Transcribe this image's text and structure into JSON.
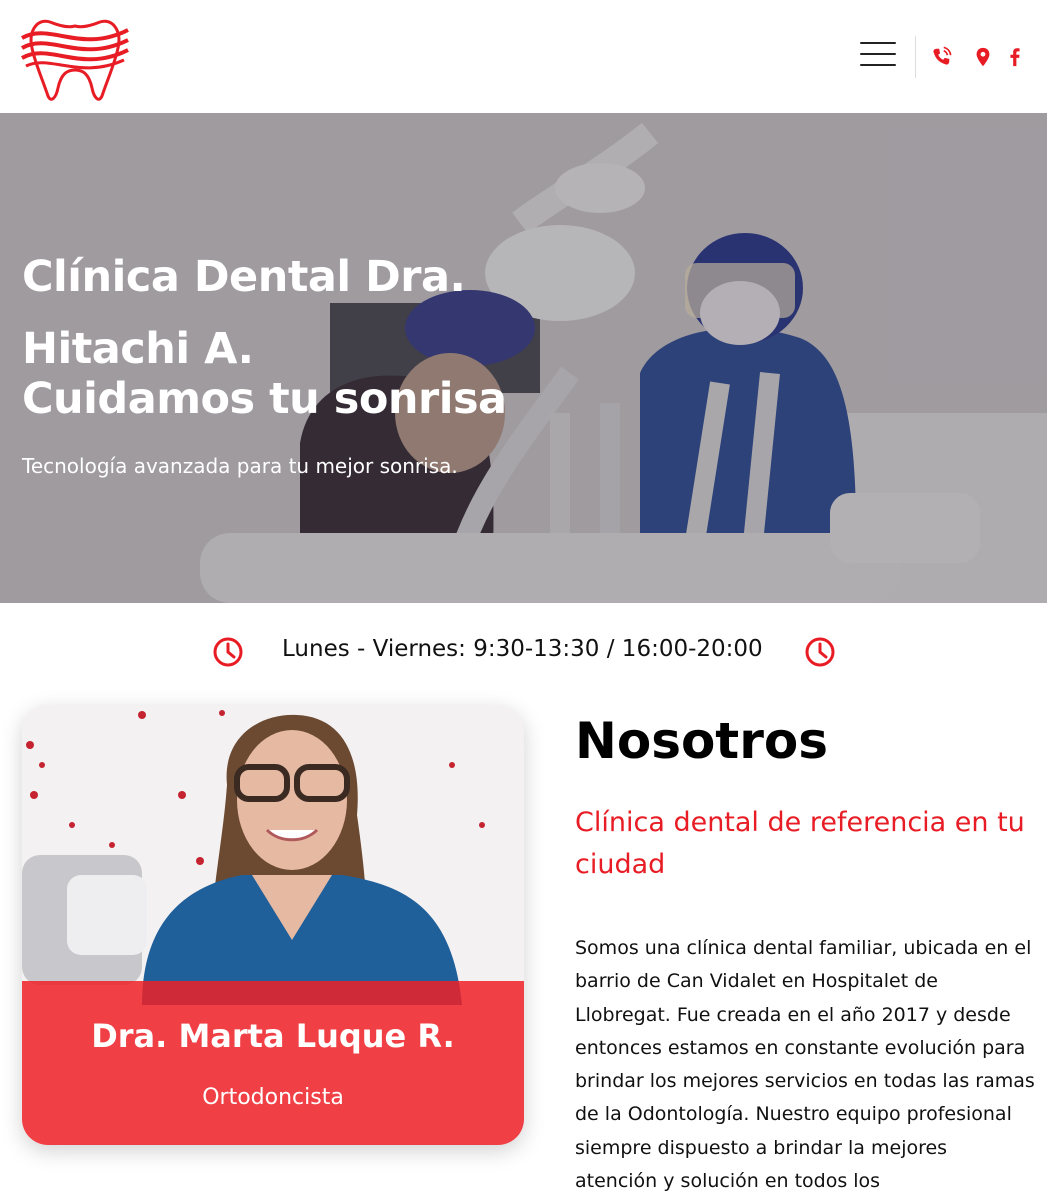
{
  "header": {
    "logo_icon": "tooth-logo-icon",
    "menu_icon": "hamburger-menu-icon",
    "icons": [
      "phone-icon",
      "location-pin-icon",
      "facebook-icon"
    ]
  },
  "hero": {
    "title_line1": "Clínica Dental Dra.",
    "title_line2": "Hitachi A.",
    "title_line3": "Cuidamos tu sonrisa",
    "subtitle": "Tecnología avanzada para tu mejor sonrisa."
  },
  "hours": {
    "text": "Lunes - Viernes: 9:30-13:30 / 16:00-20:00",
    "icon": "clock-icon"
  },
  "doctor": {
    "name": "Dra. Marta Luque R.",
    "role": "Ortodoncista"
  },
  "about": {
    "title": "Nosotros",
    "subtitle": "Clínica dental de referencia en tu ciudad",
    "body": "Somos una clínica dental familiar, ubicada en el barrio de Can Vidalet en Hospitalet de Llobregat. Fue creada en el año 2017 y desde entonces estamos en constante evolución para brindar los mejores servicios en todas las ramas de la Odontología. Nuestro equipo profesional siempre dispuesto a brindar la mejores atención y solución en todos los"
  },
  "colors": {
    "accent": "#e81c24",
    "text": "#111111",
    "background": "#ffffff"
  }
}
